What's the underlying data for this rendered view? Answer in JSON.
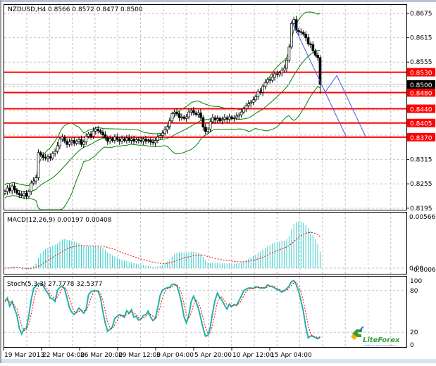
{
  "header": {
    "symbol": "NZDUSD,H4",
    "ohlc": "0.8566 0.8572 0.8477 0.8500"
  },
  "chart_data": {
    "type": "candlestick",
    "title": "NZDUSD,H4",
    "ylim": [
      0.8195,
      0.8675
    ],
    "price_ticks": [
      "0.8675",
      "0.8615",
      "0.8555",
      "0.8315",
      "0.8255",
      "0.8195"
    ],
    "price_tick_values": [
      0.8675,
      0.8615,
      0.8555,
      0.8315,
      0.8255,
      0.8195
    ],
    "grid_prices": [
      0.8675,
      0.8615,
      0.8555,
      0.8495,
      0.8435,
      0.8375,
      0.8315,
      0.8255,
      0.8195
    ],
    "current_price": {
      "value": 0.85,
      "label": "0.8500"
    },
    "levels": [
      {
        "value": 0.853,
        "label": "0.8530"
      },
      {
        "value": 0.848,
        "label": "0.8480"
      },
      {
        "value": 0.844,
        "label": "0.8440"
      },
      {
        "value": 0.8405,
        "label": "0.8405"
      },
      {
        "value": 0.837,
        "label": "0.8370"
      }
    ],
    "closes": [
      0.8236,
      0.8245,
      0.8238,
      0.825,
      0.824,
      0.8232,
      0.8228,
      0.8226,
      0.8232,
      0.8224,
      0.8236,
      0.8257,
      0.8262,
      0.827,
      0.8332,
      0.8326,
      0.832,
      0.8318,
      0.8322,
      0.8318,
      0.833,
      0.8335,
      0.8349,
      0.8365,
      0.837,
      0.836,
      0.8352,
      0.8358,
      0.8362,
      0.8355,
      0.836,
      0.8364,
      0.8352,
      0.8358,
      0.8372,
      0.8378,
      0.8372,
      0.8385,
      0.839,
      0.8386,
      0.8382,
      0.8376,
      0.8368,
      0.836,
      0.8366,
      0.8362,
      0.837,
      0.8364,
      0.836,
      0.8366,
      0.8362,
      0.8368,
      0.8362,
      0.8366,
      0.836,
      0.8364,
      0.8362,
      0.836,
      0.8365,
      0.836,
      0.8362,
      0.8358,
      0.8356,
      0.8362,
      0.837,
      0.8374,
      0.838,
      0.8388,
      0.8396,
      0.841,
      0.8428,
      0.8432,
      0.8428,
      0.8418,
      0.842,
      0.8416,
      0.842,
      0.8432,
      0.8436,
      0.843,
      0.8426,
      0.843,
      0.8418,
      0.8395,
      0.8384,
      0.839,
      0.8408,
      0.8418,
      0.8412,
      0.8416,
      0.841,
      0.8414,
      0.8418,
      0.8414,
      0.842,
      0.8416,
      0.8418,
      0.8422,
      0.8425,
      0.8432,
      0.844,
      0.8448,
      0.8452,
      0.8456,
      0.8462,
      0.847,
      0.8482,
      0.848,
      0.8495,
      0.8505,
      0.8512,
      0.851,
      0.8518,
      0.8526,
      0.8524,
      0.8528,
      0.8535,
      0.854,
      0.856,
      0.8592,
      0.865,
      0.866,
      0.8633,
      0.863,
      0.8628,
      0.8624,
      0.8615,
      0.86,
      0.8598,
      0.8583,
      0.8572,
      0.8566,
      0.85
    ],
    "bollinger": {
      "period": 20,
      "deviation": 2
    },
    "trend_lines": [
      {
        "points": [
          [
            120,
            0.8657
          ],
          [
            143,
            0.837
          ]
        ]
      },
      {
        "points": [
          [
            134,
            0.848
          ],
          [
            139,
            0.8522
          ],
          [
            151,
            0.8372
          ]
        ]
      }
    ],
    "time_labels": [
      "19 Mar 2013",
      "22 Mar 04:00",
      "26 Mar 20:00",
      "29 Mar 12:00",
      "3 Apr 04:00",
      "5 Apr 20:00",
      "10 Apr 12:00",
      "15 Apr 04:00"
    ],
    "macd": {
      "label": "MACD(12,26,9) 0.00197 0.00408",
      "fast": 12,
      "slow": 26,
      "signal": 9,
      "top_label": "0.00566",
      "zero_label": "0.00",
      "bottom_label": "-0.00062",
      "ylim": [
        -0.00062,
        0.00566
      ]
    },
    "stoch": {
      "label": "Stoch(5,3,3) 27.7778 32.5377",
      "k": 5,
      "d": 3,
      "slowing": 3,
      "ticks": [
        "100",
        "80",
        "20",
        "0"
      ],
      "tick_values": [
        100,
        80,
        20,
        0
      ],
      "ylim": [
        0,
        100
      ]
    }
  },
  "logo": {
    "name": "LiteForex",
    "tagline": "The World of Financial Freedom"
  },
  "colors": {
    "level": "#ff0000",
    "bands": "#008000",
    "macd_hist": "#33cccc",
    "signal": "#ff0000",
    "stoch_main": "#20b2aa",
    "trend": "#4a5ce0"
  }
}
